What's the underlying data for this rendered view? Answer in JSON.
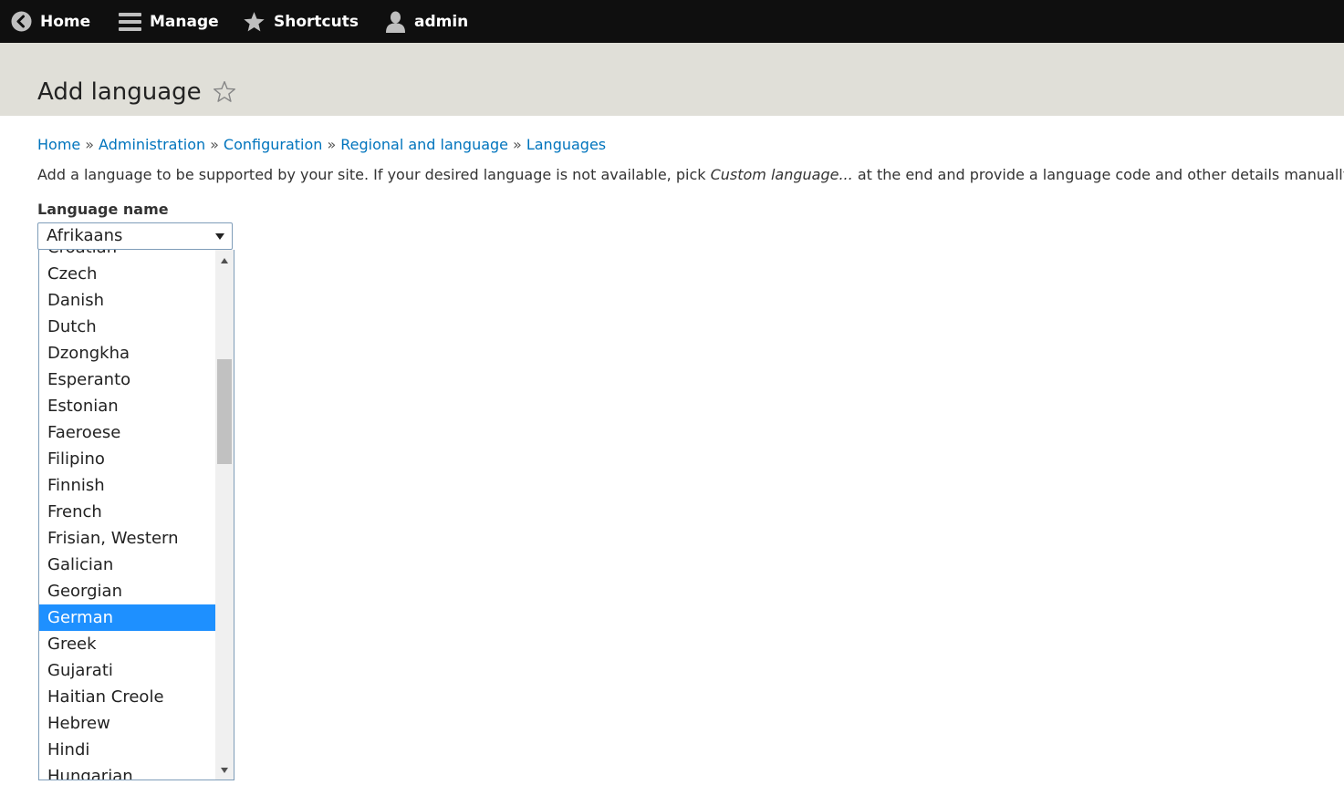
{
  "toolbar": {
    "home_label": "Home",
    "manage_label": "Manage",
    "shortcuts_label": "Shortcuts",
    "user_label": "admin"
  },
  "page": {
    "title": "Add language"
  },
  "breadcrumb": {
    "items": [
      "Home",
      "Administration",
      "Configuration",
      "Regional and language",
      "Languages"
    ],
    "separator": "»"
  },
  "help": {
    "before": "Add a language to be supported by your site. If your desired language is not available, pick ",
    "emphasis": "Custom language...",
    "after": " at the end and provide a language code and other details manually."
  },
  "form": {
    "language_label": "Language name",
    "selected_value": "Afrikaans",
    "highlighted_option": "German",
    "visible_options": [
      "Croatian",
      "Czech",
      "Danish",
      "Dutch",
      "Dzongkha",
      "Esperanto",
      "Estonian",
      "Faeroese",
      "Filipino",
      "Finnish",
      "French",
      "Frisian, Western",
      "Galician",
      "Georgian",
      "German",
      "Greek",
      "Gujarati",
      "Haitian Creole",
      "Hebrew",
      "Hindi",
      "Hungarian"
    ]
  },
  "colors": {
    "toolbar_bg": "#0f0f0f",
    "header_bg": "#e0dfd8",
    "link": "#0074bd",
    "highlight": "#1e90ff"
  },
  "icons": {
    "home": "back-arrow-circle-icon",
    "manage": "hamburger-menu-icon",
    "shortcuts": "star-icon",
    "user": "user-icon",
    "favorite": "star-outline-icon"
  }
}
